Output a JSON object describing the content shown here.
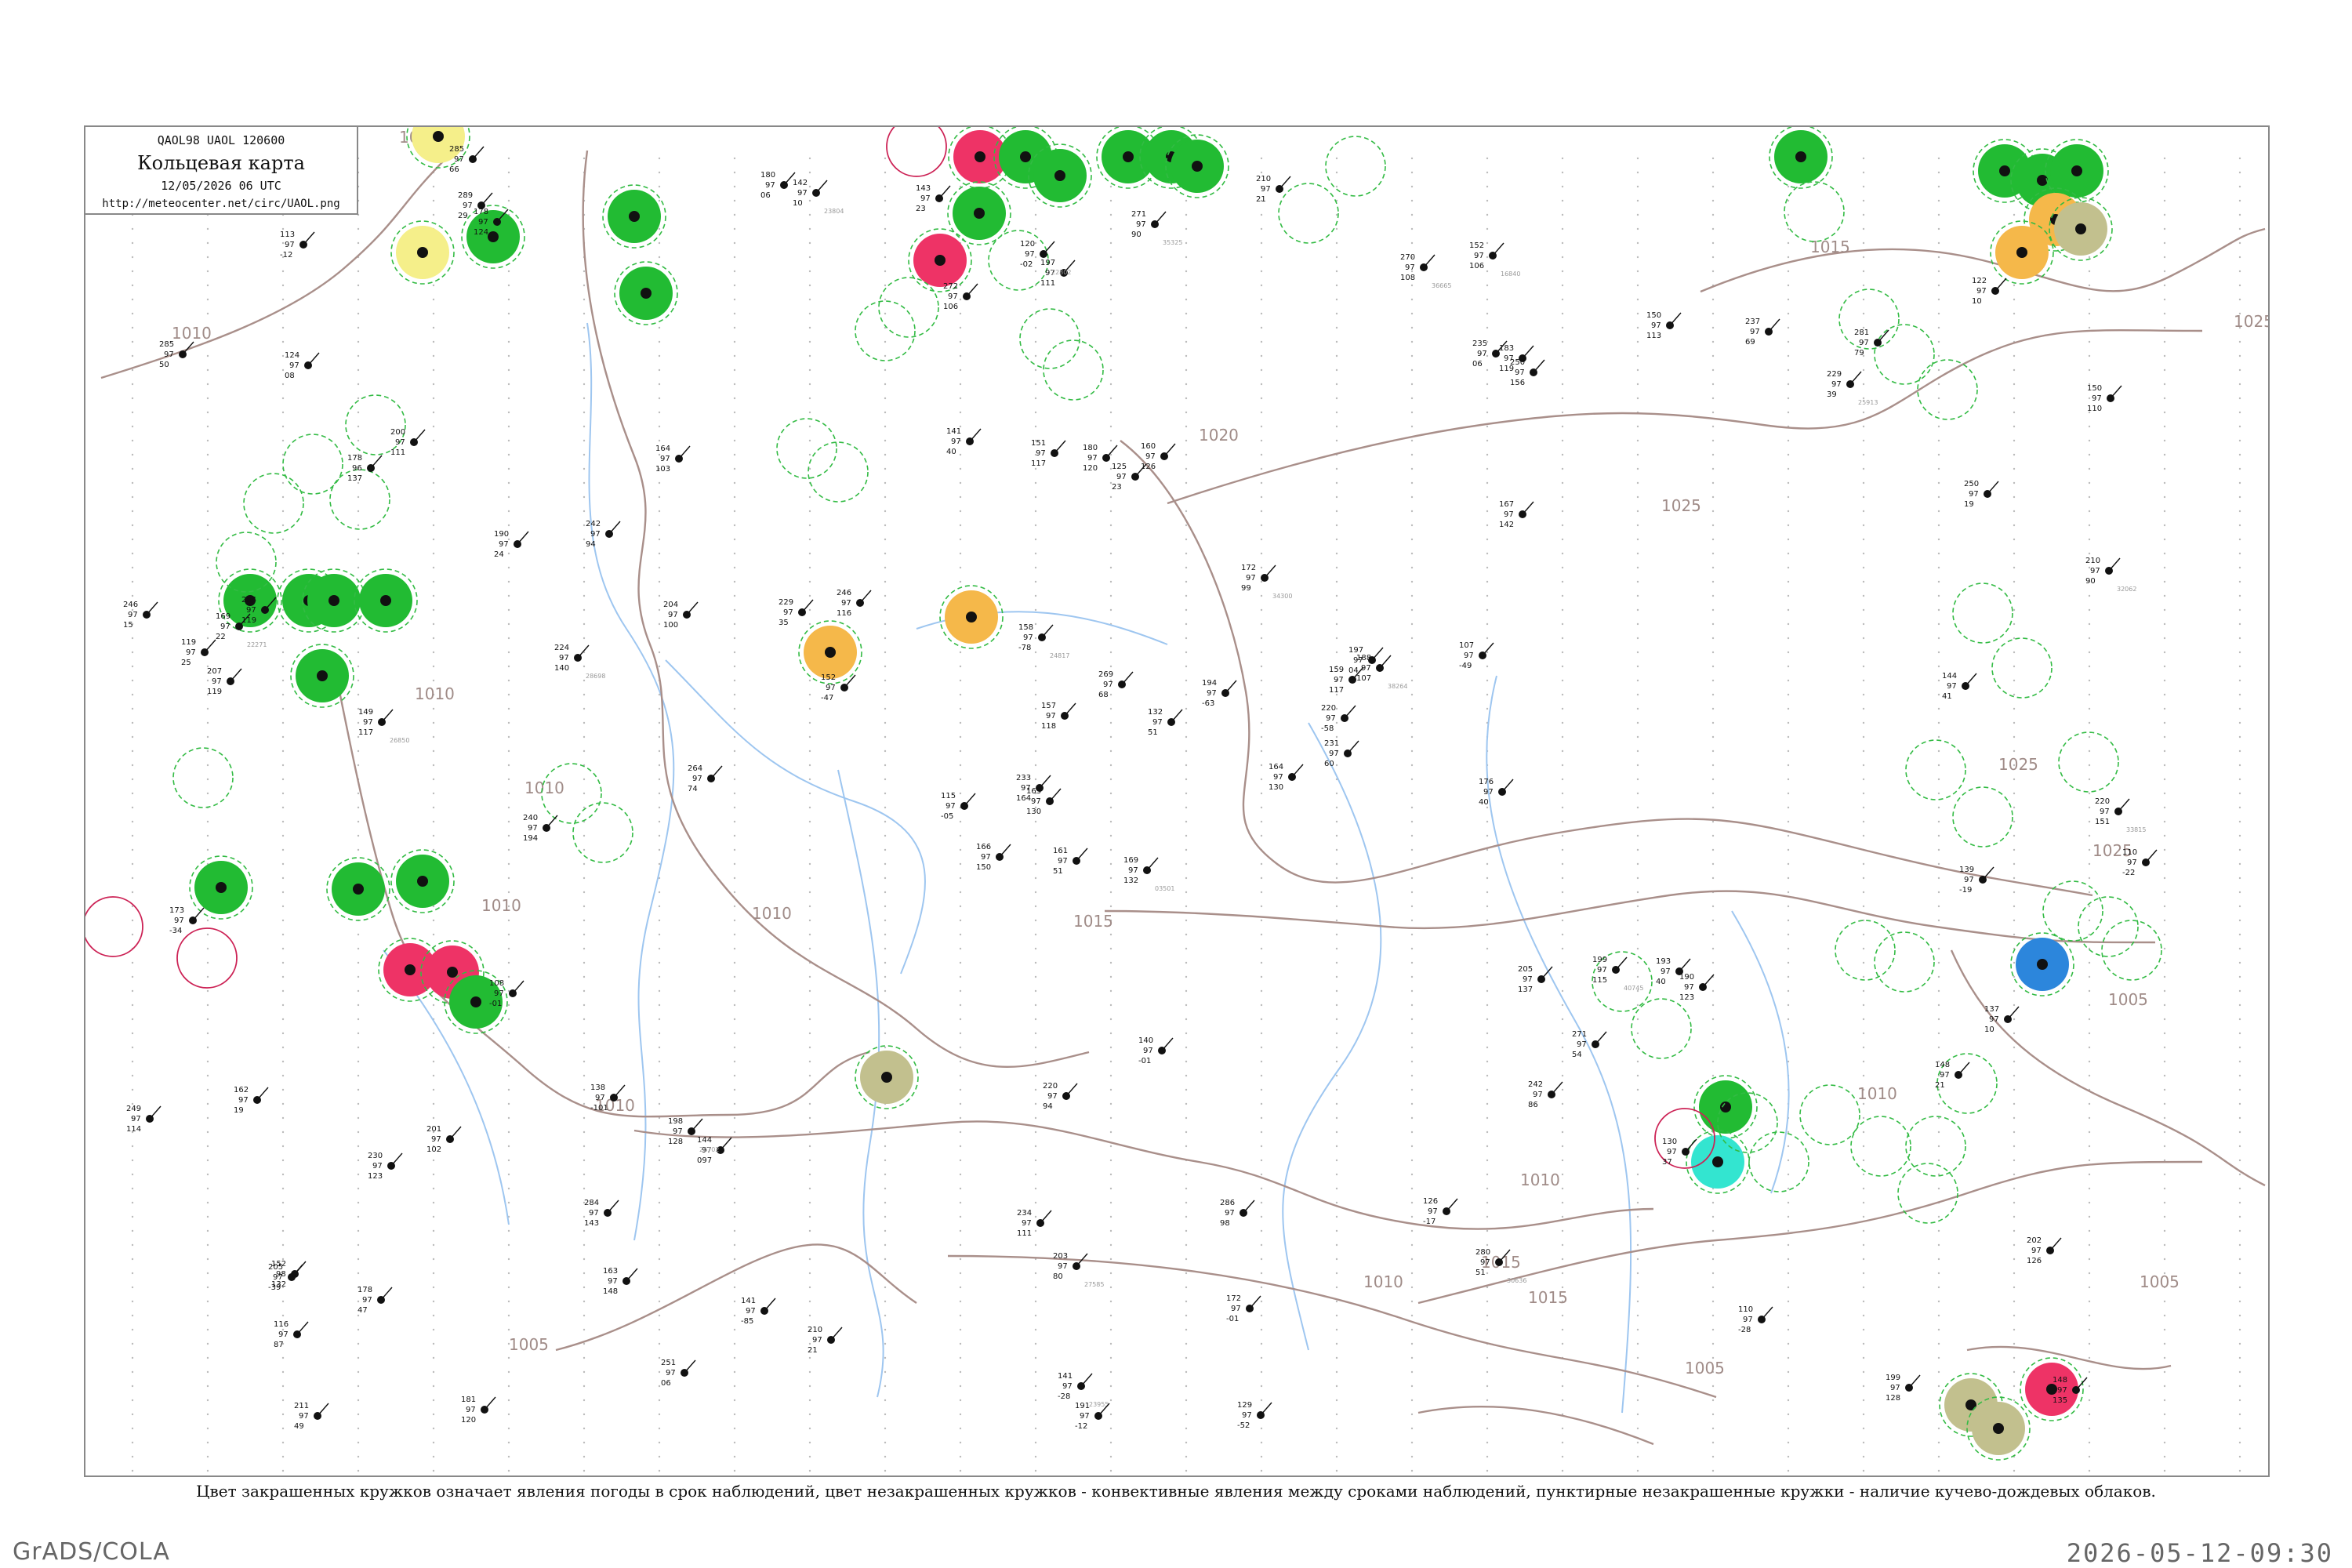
{
  "header": {
    "codes": "QAOL98  UAOL  120600",
    "title": "Кольцевая карта",
    "datetime": "12/05/2026 06 UTC",
    "url": "http://meteocenter.net/circ/UAOL.png"
  },
  "legend_note": "Цвет закрашенных кружков означает явления погоды в срок наблюдений, цвет незакрашенных кружков - конвективные явления между сроками наблюдений, пунктирные незакрашенные кружки - наличие кучево-дождевых облаков.",
  "footer": {
    "software": "GrADS/COLA",
    "timestamp": "2026-05-12-09:30"
  },
  "isobar_labels": [
    "1010",
    "1010",
    "1010",
    "1010",
    "1010",
    "1010",
    "1010",
    "1015",
    "1015",
    "1015",
    "1020",
    "1025",
    "1025",
    "1025",
    "1025",
    "1005",
    "1005",
    "1005",
    "1005",
    "1010",
    "1015",
    "1010",
    "1010"
  ],
  "colors": {
    "rain": "#22bb33",
    "thunder": "#ee3366",
    "haze": "#f5b84a",
    "fog_mist": "#f5ef8a",
    "dust": "#c2c08e",
    "snow": "#2c86dc",
    "drizzle": "#33e5d0",
    "cb_dashed": "#33bb44",
    "convective_ring": "#cc2255",
    "isobar": "#a98f8a",
    "river": "#9ec6f0"
  },
  "filled_station_markers": [
    {
      "kind": "fog_mist"
    },
    {
      "kind": "fog_mist"
    },
    {
      "kind": "rain"
    },
    {
      "kind": "rain"
    },
    {
      "kind": "rain"
    },
    {
      "kind": "rain"
    },
    {
      "kind": "rain"
    },
    {
      "kind": "rain"
    },
    {
      "kind": "rain"
    },
    {
      "kind": "rain"
    },
    {
      "kind": "rain"
    },
    {
      "kind": "thunder"
    },
    {
      "kind": "thunder"
    },
    {
      "kind": "rain"
    },
    {
      "kind": "rain"
    },
    {
      "kind": "thunder"
    },
    {
      "kind": "thunder"
    },
    {
      "kind": "rain"
    },
    {
      "kind": "rain"
    },
    {
      "kind": "rain"
    },
    {
      "kind": "rain"
    },
    {
      "kind": "rain"
    },
    {
      "kind": "rain"
    },
    {
      "kind": "haze"
    },
    {
      "kind": "haze"
    },
    {
      "kind": "haze"
    },
    {
      "kind": "dust"
    },
    {
      "kind": "rain"
    },
    {
      "kind": "rain"
    },
    {
      "kind": "rain"
    },
    {
      "kind": "rain"
    },
    {
      "kind": "haze"
    },
    {
      "kind": "haze"
    },
    {
      "kind": "snow"
    },
    {
      "kind": "rain"
    },
    {
      "kind": "drizzle"
    },
    {
      "kind": "dust"
    },
    {
      "kind": "dust"
    },
    {
      "kind": "thunder"
    }
  ],
  "stations": [
    {
      "id": "s1",
      "t": "169",
      "p": "97",
      "n": "132"
    },
    {
      "id": "s2",
      "t": "178",
      "p": "96",
      "n": "137"
    },
    {
      "id": "s3",
      "t": "163",
      "p": "97",
      "n": "130"
    },
    {
      "id": "s4",
      "t": "152",
      "p": "98",
      "n": "132"
    },
    {
      "id": "s5",
      "t": "159",
      "p": "97",
      "n": "117"
    },
    {
      "id": "s6",
      "t": "144",
      "p": "97",
      "n": "097"
    },
    {
      "id": "s7",
      "t": "152",
      "p": "97",
      "n": "106"
    },
    {
      "id": "s8",
      "t": "160",
      "p": "97",
      "n": "126"
    },
    {
      "id": "s9",
      "t": "183",
      "p": "97",
      "n": "119"
    },
    {
      "id": "s10",
      "t": "164",
      "p": "97",
      "n": "130"
    },
    {
      "id": "s11",
      "t": "178",
      "p": "97",
      "n": "124"
    },
    {
      "id": "s12",
      "t": "148",
      "p": "97",
      "n": "135"
    },
    {
      "id": "s13",
      "t": "149",
      "p": "97",
      "n": "117"
    },
    {
      "id": "s14",
      "t": "150",
      "p": "97",
      "n": "110"
    },
    {
      "id": "s15",
      "t": "166",
      "p": "97",
      "n": "150"
    },
    {
      "id": "s16",
      "t": "167",
      "p": "97",
      "n": "142"
    },
    {
      "id": "s17",
      "t": "181",
      "p": "97",
      "n": "120"
    },
    {
      "id": "s18",
      "t": "151",
      "p": "97",
      "n": "117"
    },
    {
      "id": "s19",
      "t": "172",
      "p": "97",
      "n": "99"
    },
    {
      "id": "s20",
      "t": "201",
      "p": "97",
      "n": "102"
    },
    {
      "id": "s21",
      "t": "246",
      "p": "97",
      "n": "116"
    },
    {
      "id": "s22",
      "t": "116",
      "p": "97",
      "n": "87"
    },
    {
      "id": "s23",
      "t": "163",
      "p": "97",
      "n": "148"
    },
    {
      "id": "s24",
      "t": "180",
      "p": "97",
      "n": "120"
    },
    {
      "id": "s25",
      "t": "188",
      "p": "97",
      "n": "107"
    },
    {
      "id": "s26",
      "t": "190",
      "p": "97",
      "n": "123"
    },
    {
      "id": "s27",
      "t": "200",
      "p": "97",
      "n": "111"
    },
    {
      "id": "s28",
      "t": "197",
      "p": "97",
      "n": "111"
    },
    {
      "id": "s29",
      "t": "207",
      "p": "97",
      "n": "119"
    },
    {
      "id": "s30",
      "t": "205",
      "p": "97",
      "n": "137"
    },
    {
      "id": "s31",
      "t": "210",
      "p": "97",
      "n": "90"
    },
    {
      "id": "s32",
      "t": "233",
      "p": "97",
      "n": "164"
    },
    {
      "id": "s33",
      "t": "234",
      "p": "97",
      "n": "111"
    },
    {
      "id": "s34",
      "t": "157",
      "p": "97",
      "n": "118"
    },
    {
      "id": "s35",
      "t": "164",
      "p": "97",
      "n": "103"
    },
    {
      "id": "s36",
      "t": "150",
      "p": "97",
      "n": "113"
    },
    {
      "id": "s37",
      "t": "198",
      "p": "97",
      "n": "128"
    },
    {
      "id": "s38",
      "t": "199",
      "p": "97",
      "n": "128"
    },
    {
      "id": "s39",
      "t": "202",
      "p": "97",
      "n": "126"
    },
    {
      "id": "s40",
      "t": "193",
      "p": "97",
      "n": "40"
    },
    {
      "id": "s41",
      "t": "210",
      "p": "97",
      "n": "21"
    },
    {
      "id": "s42",
      "t": "229",
      "p": "97",
      "n": "35"
    },
    {
      "id": "s43",
      "t": "224",
      "p": "97",
      "n": "140"
    },
    {
      "id": "s44",
      "t": "242",
      "p": "97",
      "n": "86"
    },
    {
      "id": "s45",
      "t": "251",
      "p": "97",
      "n": "06"
    },
    {
      "id": "s46",
      "t": "246",
      "p": "97",
      "n": "15"
    },
    {
      "id": "s47",
      "t": "220",
      "p": "97",
      "n": "-58"
    },
    {
      "id": "s48",
      "t": "211",
      "p": "97",
      "n": "49"
    },
    {
      "id": "s49",
      "t": "203",
      "p": "97",
      "n": "80"
    },
    {
      "id": "s50",
      "t": "231",
      "p": "97",
      "n": "60"
    },
    {
      "id": "s51",
      "t": "230",
      "p": "97",
      "n": "123"
    },
    {
      "id": "s52",
      "t": "250",
      "p": "97",
      "n": "19"
    },
    {
      "id": "s53",
      "t": "285",
      "p": "97",
      "n": "50"
    },
    {
      "id": "s54",
      "t": "271",
      "p": "97",
      "n": "54"
    },
    {
      "id": "s55",
      "t": "280",
      "p": "97",
      "n": "51"
    },
    {
      "id": "s56",
      "t": "284",
      "p": "97",
      "n": "143"
    },
    {
      "id": "s57",
      "t": "289",
      "p": "97",
      "n": "29"
    },
    {
      "id": "s58",
      "t": "268",
      "p": "97",
      "n": "101"
    },
    {
      "id": "s59",
      "t": "286",
      "p": "97",
      "n": "98"
    },
    {
      "id": "s60",
      "t": "281",
      "p": "97",
      "n": "79"
    },
    {
      "id": "s61",
      "t": "271",
      "p": "97",
      "n": "90"
    },
    {
      "id": "s62",
      "t": "264",
      "p": "97",
      "n": "74"
    },
    {
      "id": "s63",
      "t": "284",
      "p": "97",
      "n": "119"
    },
    {
      "id": "s64",
      "t": "242",
      "p": "97",
      "n": "94"
    },
    {
      "id": "s65",
      "t": "237",
      "p": "97",
      "n": "69"
    },
    {
      "id": "s66",
      "t": "285",
      "p": "97",
      "n": "66"
    },
    {
      "id": "s67",
      "t": "270",
      "p": "97",
      "n": "108"
    },
    {
      "id": "s68",
      "t": "272",
      "p": "97",
      "n": "106"
    },
    {
      "id": "s69",
      "t": "269",
      "p": "97",
      "n": "68"
    },
    {
      "id": "s70",
      "t": "249",
      "p": "97",
      "n": "114"
    },
    {
      "id": "s71",
      "t": "220",
      "p": "97",
      "n": "94"
    },
    {
      "id": "s72",
      "t": "210",
      "p": "97",
      "n": "21"
    },
    {
      "id": "s73",
      "t": "199",
      "p": "97",
      "n": "115"
    },
    {
      "id": "s74",
      "t": "204",
      "p": "97",
      "n": "100"
    },
    {
      "id": "s75",
      "t": "205",
      "p": "97",
      "n": "-39"
    },
    {
      "id": "s76",
      "t": "113",
      "p": "97",
      "n": "-12"
    },
    {
      "id": "s77",
      "t": "190",
      "p": "97",
      "n": "24"
    },
    {
      "id": "s78",
      "t": "173",
      "p": "97",
      "n": "-34"
    },
    {
      "id": "s79",
      "t": "158",
      "p": "97",
      "n": "-78"
    },
    {
      "id": "s80",
      "t": "172",
      "p": "97",
      "n": "-01"
    },
    {
      "id": "s81",
      "t": "194",
      "p": "97",
      "n": "-63"
    },
    {
      "id": "s82",
      "t": "178",
      "p": "97",
      "n": "47"
    },
    {
      "id": "s83",
      "t": "176",
      "p": "97",
      "n": "40"
    },
    {
      "id": "s84",
      "t": "137",
      "p": "97",
      "n": "10"
    },
    {
      "id": "s85",
      "t": "141",
      "p": "97",
      "n": "-28"
    },
    {
      "id": "s86",
      "t": "144",
      "p": "97",
      "n": "41"
    },
    {
      "id": "s87",
      "t": "140",
      "p": "97",
      "n": "-01"
    },
    {
      "id": "s88",
      "t": "110",
      "p": "97",
      "n": "-28"
    },
    {
      "id": "s89",
      "t": "129",
      "p": "97",
      "n": "-52"
    },
    {
      "id": "s90",
      "t": "126",
      "p": "97",
      "n": "-17"
    },
    {
      "id": "s91",
      "t": "120",
      "p": "97",
      "n": "-02"
    },
    {
      "id": "s92",
      "t": "110",
      "p": "97",
      "n": "-22"
    },
    {
      "id": "s93",
      "t": "107",
      "p": "97",
      "n": "-49"
    },
    {
      "id": "s94",
      "t": "130",
      "p": "97",
      "n": "37"
    },
    {
      "id": "s95",
      "t": "132",
      "p": "97",
      "n": "51"
    },
    {
      "id": "s96",
      "t": "148",
      "p": "97",
      "n": "21"
    },
    {
      "id": "s97",
      "t": "169",
      "p": "97",
      "n": "22"
    },
    {
      "id": "s98",
      "t": "191",
      "p": "97",
      "n": "-12"
    },
    {
      "id": "s99",
      "t": "235",
      "p": "97",
      "n": "06"
    },
    {
      "id": "s100",
      "t": "250",
      "p": "97",
      "n": "156"
    },
    {
      "id": "s101",
      "t": "240",
      "p": "97",
      "n": "194"
    },
    {
      "id": "s102",
      "t": "180",
      "p": "97",
      "n": "06"
    },
    {
      "id": "s103",
      "t": "220",
      "p": "97",
      "n": "151"
    },
    {
      "id": "s104",
      "t": "119",
      "p": "97",
      "n": "25"
    },
    {
      "id": "s105",
      "t": "108",
      "p": "97",
      "n": "-01"
    },
    {
      "id": "s106",
      "t": "138",
      "p": "97",
      "n": "-101"
    },
    {
      "id": "s107",
      "t": "141",
      "p": "97",
      "n": "-85"
    },
    {
      "id": "s108",
      "t": "197",
      "p": "97",
      "n": "04"
    },
    {
      "id": "s109",
      "t": "229",
      "p": "97",
      "n": "39"
    },
    {
      "id": "s110",
      "t": "152",
      "p": "97",
      "n": "-47"
    },
    {
      "id": "s111",
      "t": "139",
      "p": "97",
      "n": "-19"
    },
    {
      "id": "s112",
      "t": "124",
      "p": "97",
      "n": "08"
    },
    {
      "id": "s113",
      "t": "125",
      "p": "97",
      "n": "23"
    },
    {
      "id": "s114",
      "t": "115",
      "p": "97",
      "n": "-05"
    },
    {
      "id": "s115",
      "t": "142",
      "p": "97",
      "n": "10"
    },
    {
      "id": "s116",
      "t": "162",
      "p": "97",
      "n": "19"
    },
    {
      "id": "s117",
      "t": "161",
      "p": "97",
      "n": "51"
    },
    {
      "id": "s118",
      "t": "122",
      "p": "97",
      "n": "10"
    },
    {
      "id": "s119",
      "t": "141",
      "p": "97",
      "n": "40"
    },
    {
      "id": "s120",
      "t": "143",
      "p": "97",
      "n": "23"
    }
  ],
  "station_names": [
    "03501",
    "16840",
    "26850",
    "34300",
    "38264",
    "32062",
    "26702",
    "28698",
    "27585",
    "30636",
    "35325",
    "36665",
    "40745",
    "24817",
    "23955",
    "22802",
    "22271",
    "33815",
    "25913",
    "23804"
  ]
}
